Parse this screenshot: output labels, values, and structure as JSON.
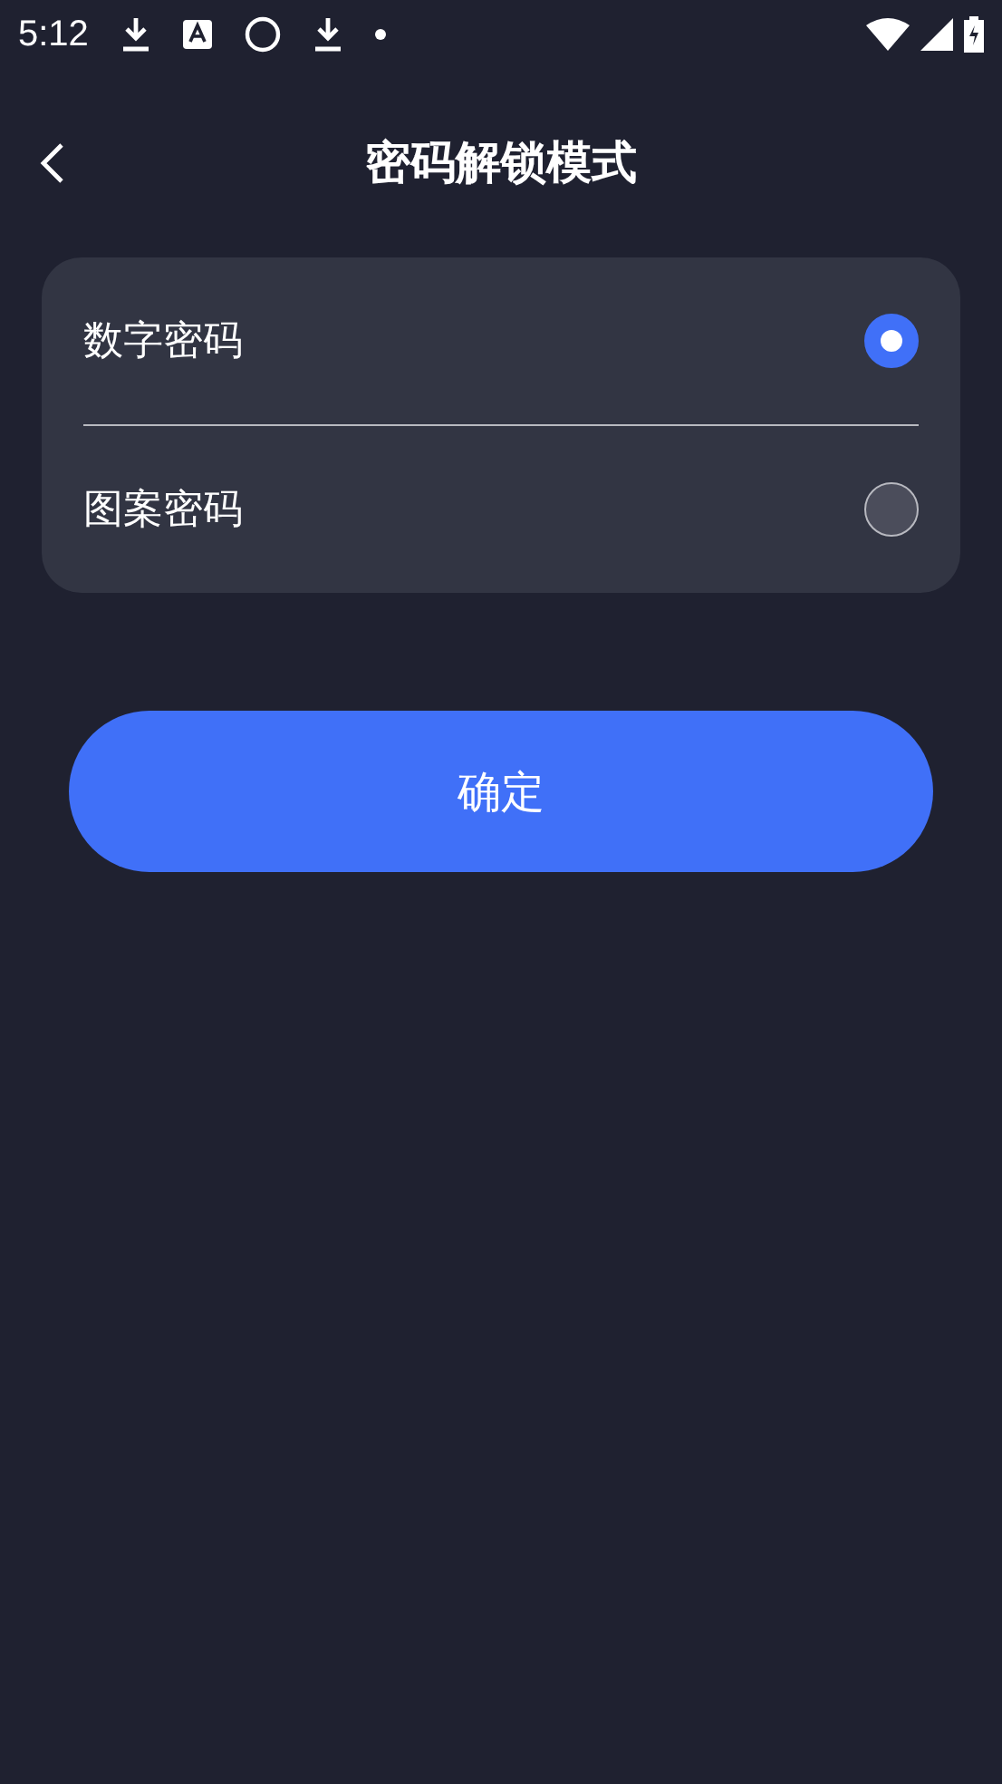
{
  "status_bar": {
    "time": "5:12"
  },
  "header": {
    "title": "密码解锁模式"
  },
  "options": [
    {
      "label": "数字密码",
      "selected": true
    },
    {
      "label": "图案密码",
      "selected": false
    }
  ],
  "confirm_button": {
    "label": "确定"
  }
}
